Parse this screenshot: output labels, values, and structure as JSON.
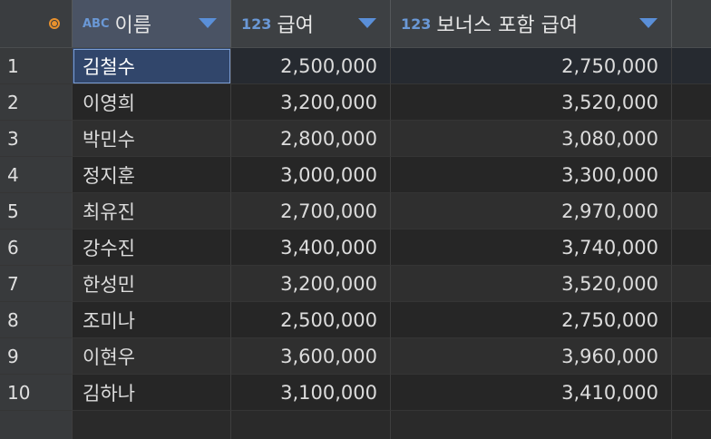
{
  "header": {
    "columns": [
      {
        "type_badge": "ABC",
        "title": "이름"
      },
      {
        "type_badge": "123",
        "title": "급여"
      },
      {
        "type_badge": "123",
        "title": "보너스 포함 급여"
      }
    ]
  },
  "rows": [
    {
      "num": "1",
      "name": "김철수",
      "salary": "2,500,000",
      "bonus": "2,750,000"
    },
    {
      "num": "2",
      "name": "이영희",
      "salary": "3,200,000",
      "bonus": "3,520,000"
    },
    {
      "num": "3",
      "name": "박민수",
      "salary": "2,800,000",
      "bonus": "3,080,000"
    },
    {
      "num": "4",
      "name": "정지훈",
      "salary": "3,000,000",
      "bonus": "3,300,000"
    },
    {
      "num": "5",
      "name": "최유진",
      "salary": "2,700,000",
      "bonus": "2,970,000"
    },
    {
      "num": "6",
      "name": "강수진",
      "salary": "3,400,000",
      "bonus": "3,740,000"
    },
    {
      "num": "7",
      "name": "한성민",
      "salary": "3,200,000",
      "bonus": "3,520,000"
    },
    {
      "num": "8",
      "name": "조미나",
      "salary": "2,500,000",
      "bonus": "2,750,000"
    },
    {
      "num": "9",
      "name": "이현우",
      "salary": "3,600,000",
      "bonus": "3,960,000"
    },
    {
      "num": "10",
      "name": "김하나",
      "salary": "3,100,000",
      "bonus": "3,410,000"
    }
  ],
  "colors": {
    "accent_orange": "#e8912d",
    "type_badge_blue": "#6a98d6",
    "sort_arrow_blue": "#5a8fd8",
    "selected_cell": "#31466b"
  },
  "icons": {
    "select_all": "radio-circle-icon",
    "sort": "triangle-down-icon"
  }
}
